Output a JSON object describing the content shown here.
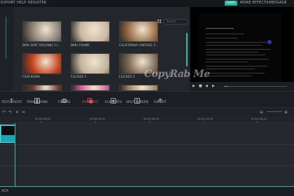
{
  "menu": {
    "export": "EXPORT",
    "help": "HELP",
    "register": "REGISTER",
    "save": "SAVE",
    "more_effects": "MORE EFFECTS",
    "messages": "MESSAGE"
  },
  "library": {
    "search_placeholder": "Search",
    "thumbnails": [
      {
        "label": "BMH DIRT ORGANIC FI...",
        "color": "#8a8176"
      },
      {
        "label": "BMH FRAME",
        "color": "#c9b7a0"
      },
      {
        "label": "CALIFORNIA VINTAGE F...",
        "color": "#9a6f4a"
      },
      {
        "label": "FILM BURN",
        "color": "#c4421e"
      },
      {
        "label": "FLICKER 1",
        "color": "#c2b29a"
      },
      {
        "label": "FLICKER 2",
        "color": "#7e6a54"
      },
      {
        "label": "",
        "color": "#6f3a2c"
      },
      {
        "label": "",
        "color": "#d3669a"
      },
      {
        "label": "",
        "color": "#aa8b6a"
      }
    ]
  },
  "preview": {
    "watermark": "CopyRab Me"
  },
  "modules": [
    {
      "label": "TEXT/CREDIT",
      "icon": "text-icon",
      "active": false
    },
    {
      "label": "TRANSITIONS",
      "icon": "transitions-icon",
      "active": false
    },
    {
      "label": "FILTERS",
      "icon": "filters-icon",
      "active": false
    },
    {
      "label": "OVERLAYS",
      "icon": "overlays-icon",
      "active": true
    },
    {
      "label": "ELEMENTS",
      "icon": "elements-icon",
      "active": false
    },
    {
      "label": "SPLIT SCREEN",
      "icon": "split-screen-icon",
      "active": false
    },
    {
      "label": "EXPORT",
      "icon": "export-icon",
      "active": false
    }
  ],
  "timeline": {
    "ticks": [
      "00:00:20:00",
      "00:00:40:00",
      "00:01:00:00",
      "00:01:20:00",
      "00:01:40:00"
    ]
  },
  "footer": {
    "back": "ACK"
  },
  "colors": {
    "accent": "#3fb9ae",
    "active_module": "#e64b5e",
    "clip": "#1aa7b4"
  }
}
